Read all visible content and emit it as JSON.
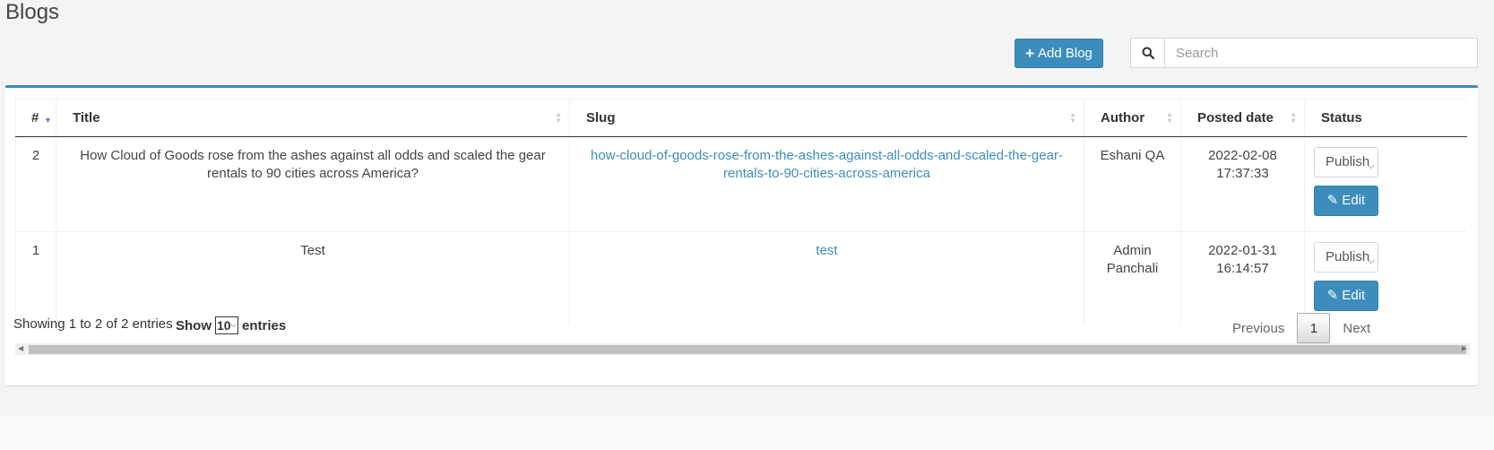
{
  "page": {
    "title": "Blogs"
  },
  "toolbar": {
    "add_label": "Add Blog",
    "search_placeholder": "Search"
  },
  "table": {
    "columns": [
      "#",
      "Title",
      "Slug",
      "Author",
      "Posted date",
      "Status"
    ],
    "rows": [
      {
        "num": "2",
        "title": "How Cloud of Goods rose from the ashes against all odds and scaled the gear rentals to 90 cities across America?",
        "slug": "how-cloud-of-goods-rose-from-the-ashes-against-all-odds-and-scaled-the-gear-rentals-to-90-cities-across-america",
        "author": "Eshani QA",
        "date": "2022-02-08",
        "time": "17:37:33",
        "status": "Publish",
        "edit_label": "Edit"
      },
      {
        "num": "1",
        "title": "Test",
        "slug": "test",
        "author": "Admin Panchali",
        "date": "2022-01-31",
        "time": "16:14:57",
        "status": "Publish",
        "edit_label": "Edit"
      }
    ]
  },
  "footer": {
    "info": "Showing 1 to 2 of 2 entries",
    "show_label": "Show",
    "length_value": "10",
    "entries_label": "entries",
    "prev_label": "Previous",
    "current_page": "1",
    "next_label": "Next"
  },
  "colors": {
    "primary": "#3c8dbc",
    "link": "#3c8dbc",
    "sort_active": "#6a7fd0"
  },
  "icons": {
    "add": "plus-icon",
    "search": "search-icon",
    "edit": "edit-icon"
  }
}
